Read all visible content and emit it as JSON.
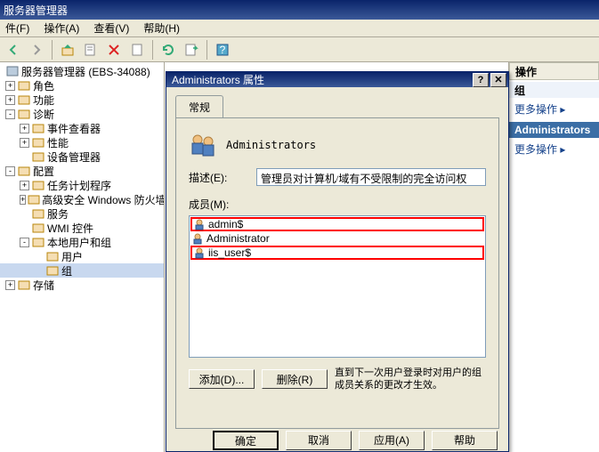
{
  "mainWindow": {
    "title": "服务器管理器",
    "menus": {
      "file": "件(F)",
      "action": "操作(A)",
      "view": "查看(V)",
      "help": "帮助(H)"
    }
  },
  "tree": {
    "root": "服务器管理器 (EBS-34088)",
    "items": [
      {
        "label": "角色",
        "depth": 2,
        "exp": "+"
      },
      {
        "label": "功能",
        "depth": 2,
        "exp": "+"
      },
      {
        "label": "诊断",
        "depth": 2,
        "exp": "-"
      },
      {
        "label": "事件查看器",
        "depth": 3,
        "exp": "+"
      },
      {
        "label": "性能",
        "depth": 3,
        "exp": "+"
      },
      {
        "label": "设备管理器",
        "depth": 3,
        "exp": ""
      },
      {
        "label": "配置",
        "depth": 2,
        "exp": "-"
      },
      {
        "label": "任务计划程序",
        "depth": 3,
        "exp": "+"
      },
      {
        "label": "高级安全 Windows 防火墙",
        "depth": 3,
        "exp": "+"
      },
      {
        "label": "服务",
        "depth": 3,
        "exp": ""
      },
      {
        "label": "WMI 控件",
        "depth": 3,
        "exp": ""
      },
      {
        "label": "本地用户和组",
        "depth": 3,
        "exp": "-"
      },
      {
        "label": "用户",
        "depth": 4,
        "exp": ""
      },
      {
        "label": "组",
        "depth": 4,
        "exp": "",
        "selected": true
      },
      {
        "label": "存储",
        "depth": 2,
        "exp": "+"
      }
    ]
  },
  "actions": {
    "header": "操作",
    "group1": "组",
    "more1": "更多操作",
    "group2": "Administrators",
    "more2": "更多操作"
  },
  "dialog": {
    "title": "Administrators 属性",
    "tab_general": "常规",
    "group_name": "Administrators",
    "desc_label": "描述(E):",
    "desc_value": "管理员对计算机/域有不受限制的完全访问权",
    "members_label": "成员(M):",
    "members": [
      "admin$",
      "Administrator",
      "iis_user$"
    ],
    "highlight_members": [
      "admin$",
      "iis_user$"
    ],
    "add_btn": "添加(D)...",
    "remove_btn": "删除(R)",
    "note": "直到下一次用户登录时对用户的组成员关系的更改才生效。",
    "ok": "确定",
    "cancel": "取消",
    "apply": "应用(A)",
    "help": "帮助"
  }
}
